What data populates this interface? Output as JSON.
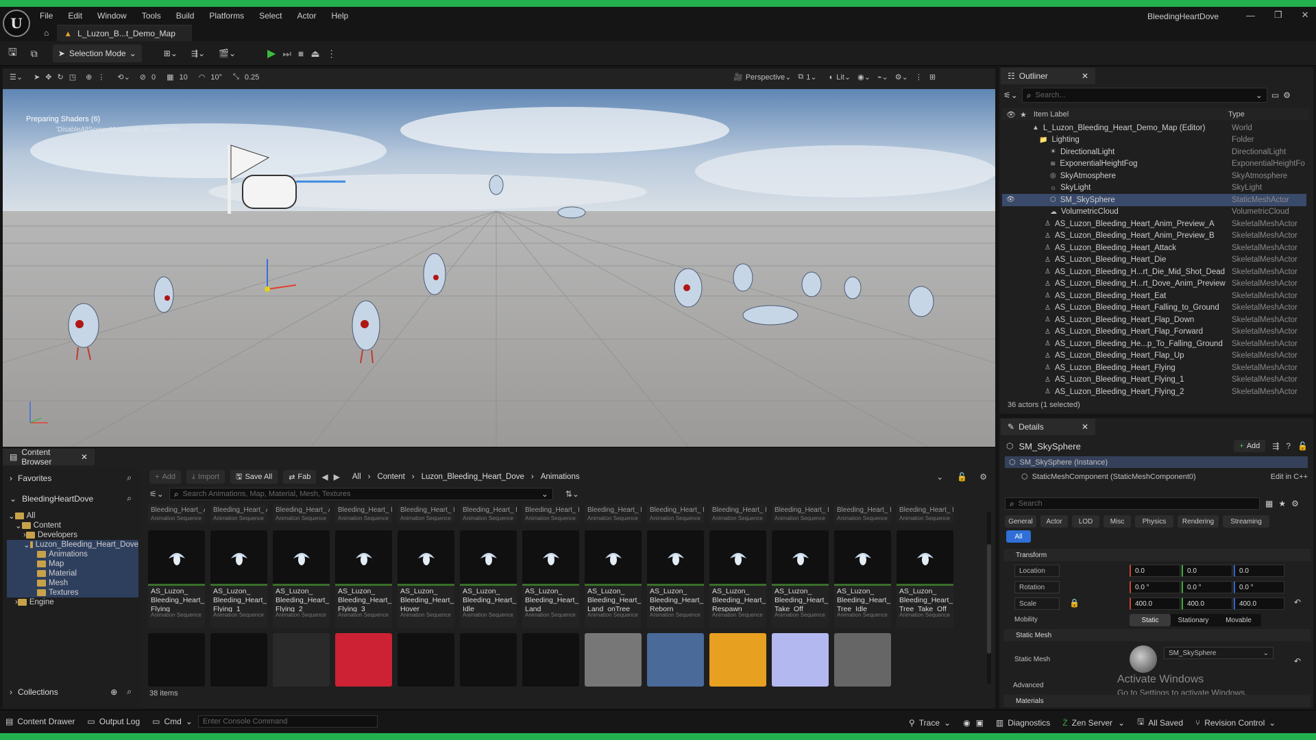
{
  "app": {
    "window_title": "BleedingHeartDove",
    "document_tab": "L_Luzon_B...t_Demo_Map"
  },
  "menu": [
    "File",
    "Edit",
    "Window",
    "Tools",
    "Build",
    "Platforms",
    "Select",
    "Actor",
    "Help"
  ],
  "toolbar": {
    "mode": "Selection Mode"
  },
  "viewport_toolbar": {
    "translate_snap": "0",
    "grid_snap": "10",
    "rotate_snap": "10°",
    "scale_snap": "0.25",
    "camera_count": "1",
    "view_type": "Perspective",
    "view_mode": "Lit",
    "camera_speed": "1"
  },
  "viewport": {
    "message": "Preparing Shaders (6)",
    "submessage": "'DisableAllScreenMessages' to suppress"
  },
  "outliner": {
    "tab": "Outliner",
    "search_placeholder": "Search...",
    "col_label": "Item Label",
    "col_type": "Type",
    "rows": [
      {
        "label": "L_Luzon_Bleeding_Heart_Demo_Map (Editor)",
        "type": "World"
      },
      {
        "label": "Lighting",
        "type": "Folder"
      },
      {
        "label": "DirectionalLight",
        "type": "DirectionalLight"
      },
      {
        "label": "ExponentialHeightFog",
        "type": "ExponentialHeightFo"
      },
      {
        "label": "SkyAtmosphere",
        "type": "SkyAtmosphere"
      },
      {
        "label": "SkyLight",
        "type": "SkyLight"
      },
      {
        "label": "SM_SkySphere",
        "type": "StaticMeshActor"
      },
      {
        "label": "VolumetricCloud",
        "type": "VolumetricCloud"
      },
      {
        "label": "AS_Luzon_Bleeding_Heart_Anim_Preview_A",
        "type": "SkeletalMeshActor"
      },
      {
        "label": "AS_Luzon_Bleeding_Heart_Anim_Preview_B",
        "type": "SkeletalMeshActor"
      },
      {
        "label": "AS_Luzon_Bleeding_Heart_Attack",
        "type": "SkeletalMeshActor"
      },
      {
        "label": "AS_Luzon_Bleeding_Heart_Die",
        "type": "SkeletalMeshActor"
      },
      {
        "label": "AS_Luzon_Bleeding_H...rt_Die_Mid_Shot_Dead",
        "type": "SkeletalMeshActor"
      },
      {
        "label": "AS_Luzon_Bleeding_H...rt_Dove_Anim_Preview",
        "type": "SkeletalMeshActor"
      },
      {
        "label": "AS_Luzon_Bleeding_Heart_Eat",
        "type": "SkeletalMeshActor"
      },
      {
        "label": "AS_Luzon_Bleeding_Heart_Falling_to_Ground",
        "type": "SkeletalMeshActor"
      },
      {
        "label": "AS_Luzon_Bleeding_Heart_Flap_Down",
        "type": "SkeletalMeshActor"
      },
      {
        "label": "AS_Luzon_Bleeding_Heart_Flap_Forward",
        "type": "SkeletalMeshActor"
      },
      {
        "label": "AS_Luzon_Bleeding_He...p_To_Falling_Ground",
        "type": "SkeletalMeshActor"
      },
      {
        "label": "AS_Luzon_Bleeding_Heart_Flap_Up",
        "type": "SkeletalMeshActor"
      },
      {
        "label": "AS_Luzon_Bleeding_Heart_Flying",
        "type": "SkeletalMeshActor"
      },
      {
        "label": "AS_Luzon_Bleeding_Heart_Flying_1",
        "type": "SkeletalMeshActor"
      },
      {
        "label": "AS_Luzon_Bleeding_Heart_Flying_2",
        "type": "SkeletalMeshActor"
      }
    ],
    "footer": "36 actors (1 selected)"
  },
  "details": {
    "tab": "Details",
    "actor": "SM_SkySphere",
    "add": "Add",
    "instance": "SM_SkySphere (Instance)",
    "component": "StaticMeshComponent (StaticMeshComponent0)",
    "edit_cpp": "Edit in C++",
    "search_placeholder": "Search",
    "filter_tabs": [
      "General",
      "Actor",
      "LOD",
      "Misc",
      "Physics",
      "Rendering",
      "Streaming"
    ],
    "all_tab": "All",
    "transform": "Transform",
    "location_label": "Location",
    "location": [
      "0.0",
      "0.0",
      "0.0"
    ],
    "rotation_label": "Rotation",
    "rotation": [
      "0.0 °",
      "0.0 °",
      "0.0 °"
    ],
    "scale_label": "Scale",
    "scale": [
      "400.0",
      "400.0",
      "400.0"
    ],
    "mobility_label": "Mobility",
    "mobility_options": [
      "Static",
      "Stationary",
      "Movable"
    ],
    "static_mesh_section": "Static Mesh",
    "static_mesh_label": "Static Mesh",
    "static_mesh_value": "SM_SkySphere",
    "advanced": "Advanced",
    "materials": "Materials",
    "watermark_1": "Activate Windows",
    "watermark_2": "Go to Settings to activate Windows."
  },
  "content_browser": {
    "tab": "Content Browser",
    "favorites": "Favorites",
    "project": "BleedingHeartDove",
    "tree": [
      "All",
      "Content",
      "Developers",
      "Luzon_Bleeding_Heart_Dove",
      "Animations",
      "Map",
      "Material",
      "Mesh",
      "Textures",
      "Engine"
    ],
    "collections": "Collections",
    "add": "Add",
    "import": "Import",
    "save_all": "Save All",
    "fab": "Fab",
    "path": [
      "All",
      "Content",
      "Luzon_Bleeding_Heart_Dove",
      "Animations"
    ],
    "search_placeholder": "Search Animations, Map, Material, Mesh, Textures",
    "top_row_labels": [
      "Bleeding_Heart_ Anim_Preview_A",
      "Bleeding_Heart_ Anim_Preview_B",
      "Bleeding_Heart_ Attack",
      "Bleeding_Heart_ Die",
      "Bleeding_Heart_ Die_Mid_Shot_",
      "Bleeding_Heart_ Dove_Anim_",
      "Bleeding_Heart_ Eat",
      "Bleeding_Heart_ Falling_to_",
      "Bleeding_Heart_ Flap_Down",
      "Bleeding_Heart_ Flap_Forward",
      "Bleeding_Heart_ Flap_To_Falling",
      "Bleeding_Heart_ Flap_Up",
      "Bleeding_Heart_ Fly_to_Land_"
    ],
    "assets": [
      {
        "name": "AS_Luzon_ Bleeding_Heart_ Flying",
        "class": "Animation Sequence"
      },
      {
        "name": "AS_Luzon_ Bleeding_Heart_ Flying_1",
        "class": "Animation Sequence"
      },
      {
        "name": "AS_Luzon_ Bleeding_Heart_ Flying_2",
        "class": "Animation Sequence"
      },
      {
        "name": "AS_Luzon_ Bleeding_Heart_ Flying_3",
        "class": "Animation Sequence"
      },
      {
        "name": "AS_Luzon_ Bleeding_Heart_ Hover",
        "class": "Animation Sequence"
      },
      {
        "name": "AS_Luzon_ Bleeding_Heart_ Idle",
        "class": "Animation Sequence"
      },
      {
        "name": "AS_Luzon_ Bleeding_Heart_ Land",
        "class": "Animation Sequence"
      },
      {
        "name": "AS_Luzon_ Bleeding_Heart_ Land_onTree",
        "class": "Animation Sequence"
      },
      {
        "name": "AS_Luzon_ Bleeding_Heart_ Reborn",
        "class": "Animation Sequence"
      },
      {
        "name": "AS_Luzon_ Bleeding_Heart_ Respawn",
        "class": "Animation Sequence"
      },
      {
        "name": "AS_Luzon_ Bleeding_Heart_ Take_Off",
        "class": "Animation Sequence"
      },
      {
        "name": "AS_Luzon_ Bleeding_Heart_ Tree_Idle",
        "class": "Animation Sequence"
      },
      {
        "name": "AS_Luzon_ Bleeding_Heart_ Tree_Take_Off",
        "class": "Animation Sequence"
      }
    ],
    "anim_class": "Animation Sequence",
    "item_count": "38 items"
  },
  "statusbar": {
    "content_drawer": "Content Drawer",
    "output_log": "Output Log",
    "cmd": "Cmd",
    "console_placeholder": "Enter Console Command",
    "trace": "Trace",
    "diagnostics": "Diagnostics",
    "zen": "Zen Server",
    "saved": "All Saved",
    "revision": "Revision Control"
  }
}
